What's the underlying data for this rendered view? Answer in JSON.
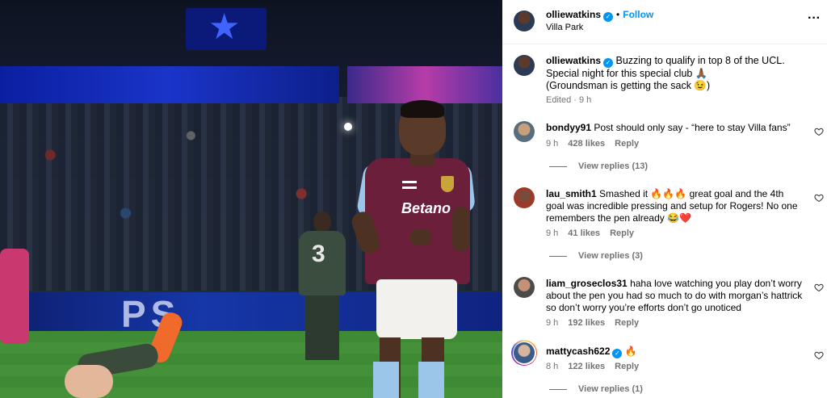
{
  "post": {
    "author": "olliewatkins",
    "follow_label": "Follow",
    "location": "Villa Park",
    "caption_line1": "Buzzing to qualify in top 8 of the UCL.",
    "caption_line2": "Special night for this special club 🙏🏾",
    "caption_line3": "(Groundsman is getting the sack 😉)",
    "meta": "Edited · 9 h"
  },
  "photo": {
    "sponsor": "Betano",
    "player_number": "3",
    "ad_text": "PS"
  },
  "comments": [
    {
      "username": "bondyy91",
      "text": "Post should only say - “here to stay Villa fans”",
      "time": "9 h",
      "likes": "428 likes",
      "reply_label": "Reply",
      "view_replies": "View replies (13)"
    },
    {
      "username": "lau_smith1",
      "text": "Smashed it 🔥🔥🔥 great goal and the 4th goal was incredible pressing and setup for Rogers! No one remembers the pen already 😂❤️",
      "time": "9 h",
      "likes": "41 likes",
      "reply_label": "Reply",
      "view_replies": "View replies (3)"
    },
    {
      "username": "liam_groseclos31",
      "text": "haha love watching you play don’t worry about the pen you had so much to do with morgan’s hattrick so don’t worry you’re efforts don’t go unoticed",
      "time": "9 h",
      "likes": "192 likes",
      "reply_label": "Reply",
      "view_replies": ""
    },
    {
      "username": "mattycash622",
      "text": "🔥",
      "time": "8 h",
      "likes": "122 likes",
      "reply_label": "Reply",
      "view_replies": "View replies (1)"
    }
  ],
  "colors": {
    "accent": "#0095f6",
    "muted": "#737373",
    "kit_claret": "#6b1f3a",
    "kit_blue": "#9cc5ea"
  }
}
